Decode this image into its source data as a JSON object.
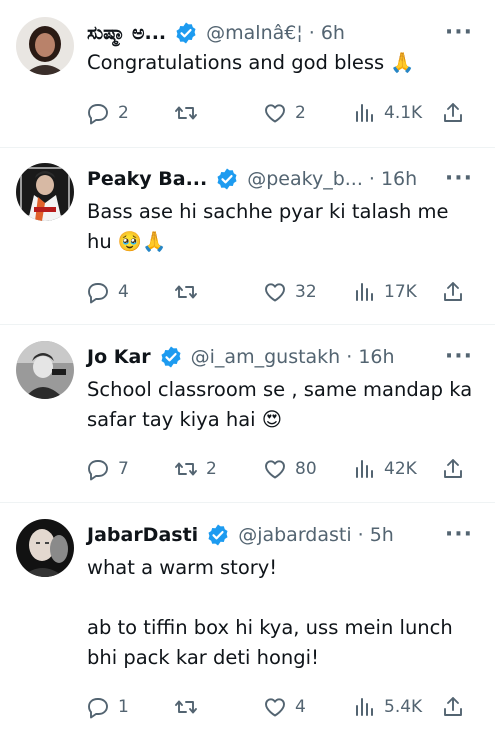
{
  "tweets": [
    {
      "name": "ಸುಷ್ಮಾ ಅ...",
      "handle": "@malnâ€¦",
      "time": "· 6h",
      "text": "Congratulations and god bless ",
      "emoji": "🙏",
      "replies": "2",
      "retweets": "",
      "likes": "2",
      "views": "4.1K",
      "avatar_icon": "woman-portrait"
    },
    {
      "name": "Peaky Ba...",
      "handle": "@peaky_b...",
      "time": "· 16h",
      "text": "Bass ase hi sachhe pyar ki talash me hu ",
      "emoji": "🥹🙏",
      "replies": "4",
      "retweets": "",
      "likes": "32",
      "views": "17K",
      "avatar_icon": "peaky-blinders-portrait"
    },
    {
      "name": "Jo Kar",
      "handle": "@i_am_gustakh",
      "time": "· 16h",
      "text": "School classroom se , same mandap ka safar tay kiya hai ",
      "emoji": "😍",
      "replies": "7",
      "retweets": "2",
      "likes": "80",
      "views": "42K",
      "avatar_icon": "joker-bw-portrait"
    },
    {
      "name": "JabarDasti",
      "handle": "@jabardasti",
      "time": "· 5h",
      "text": "what a warm story!\n\nab to tiffin box hi kya, uss mein lunch bhi pack kar deti hongi!",
      "emoji": "",
      "replies": "1",
      "retweets": "",
      "likes": "4",
      "views": "5.4K",
      "avatar_icon": "bald-man-portrait"
    }
  ],
  "colors": {
    "verified": "#1d9bf0",
    "muted": "#536471",
    "text": "#0f1419",
    "divider": "#eff3f4"
  }
}
